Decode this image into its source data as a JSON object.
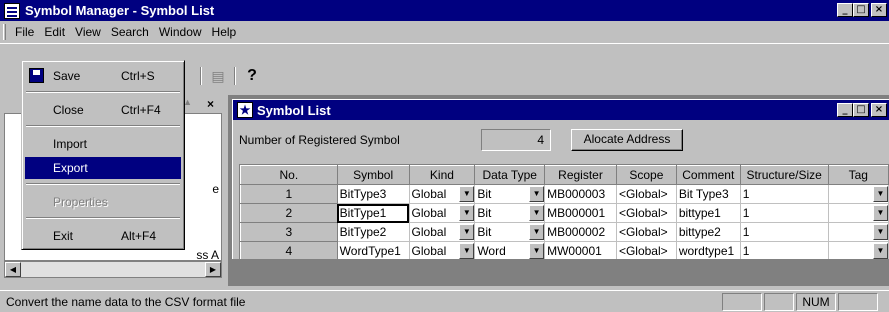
{
  "app": {
    "title": "Symbol Manager - Symbol List"
  },
  "menubar": [
    "File",
    "Edit",
    "View",
    "Search",
    "Window",
    "Help"
  ],
  "file_menu": {
    "items": [
      {
        "label": "Save",
        "shortcut": "Ctrl+S"
      },
      {
        "label": "Close",
        "shortcut": "Ctrl+F4"
      },
      {
        "label": "Import",
        "shortcut": ""
      },
      {
        "label": "Export",
        "shortcut": ""
      },
      {
        "label": "Properties",
        "shortcut": ""
      },
      {
        "label": "Exit",
        "shortcut": "Alt+F4"
      }
    ],
    "highlighted": "Export",
    "disabled": [
      "Properties"
    ]
  },
  "left_pane": {
    "fragment_1": "e",
    "fragment_2": "ss A"
  },
  "child_window": {
    "title": "Symbol List",
    "registered_label": "Number of  Registered Symbol",
    "registered_count": "4",
    "allocate_button": "Alocate Address"
  },
  "table": {
    "columns": [
      "No.",
      "Symbol",
      "Kind",
      "Data Type",
      "Register",
      "Scope",
      "Comment",
      "Structure/Size",
      "Tag"
    ],
    "rows": [
      {
        "no": "1",
        "symbol": "BitType3",
        "kind": "Global",
        "data_type": "Bit",
        "register": "MB000003",
        "scope": "<Global>",
        "comment": "Bit Type3",
        "size": "1",
        "tag": ""
      },
      {
        "no": "2",
        "symbol": "BitType1",
        "kind": "Global",
        "data_type": "Bit",
        "register": "MB000001",
        "scope": "<Global>",
        "comment": "bittype1",
        "size": "1",
        "tag": ""
      },
      {
        "no": "3",
        "symbol": "BitType2",
        "kind": "Global",
        "data_type": "Bit",
        "register": "MB000002",
        "scope": "<Global>",
        "comment": "bittype2",
        "size": "1",
        "tag": ""
      },
      {
        "no": "4",
        "symbol": "WordType1",
        "kind": "Global",
        "data_type": "Word",
        "register": "MW00001",
        "scope": "<Global>",
        "comment": "wordtype1",
        "size": "1",
        "tag": ""
      }
    ]
  },
  "status": {
    "message": "Convert the name data to the CSV format file",
    "num": "NUM"
  },
  "colors": {
    "title_bg": "#000080",
    "face": "#c0c0c0",
    "workspace": "#808080"
  }
}
